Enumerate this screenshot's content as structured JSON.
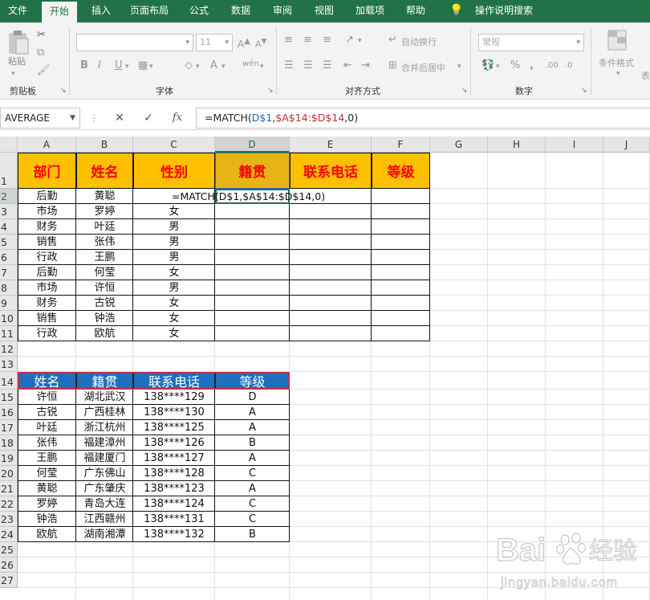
{
  "ribbon_tabs": [
    "文件",
    "开始",
    "插入",
    "页面布局",
    "公式",
    "数据",
    "审阅",
    "视图",
    "加载项",
    "帮助"
  ],
  "active_tab": "开始",
  "tell_me": "操作说明搜索",
  "ribbon": {
    "paste_label": "粘贴",
    "clipboard_label": "剪贴板",
    "font_label": "字体",
    "font_size": "11",
    "alignment_label": "对齐方式",
    "wrap_text": "自动换行",
    "merge_center": "合并后居中",
    "number_label": "数字",
    "number_format": "常规",
    "conditional_format": "条件格式",
    "table_partial": "表"
  },
  "formula_bar": {
    "name_box": "AVERAGE",
    "formula_parts": [
      {
        "text": "=MATCH(",
        "color": "default"
      },
      {
        "text": "D$1",
        "color": "blue"
      },
      {
        "text": ",",
        "color": "default"
      },
      {
        "text": "$A$14:$D$14",
        "color": "red"
      },
      {
        "text": ",0)",
        "color": "default"
      }
    ]
  },
  "columns": [
    "A",
    "B",
    "C",
    "D",
    "E",
    "F",
    "G",
    "H",
    "I",
    "J"
  ],
  "selected_column": "D",
  "selected_row": "2",
  "rows": [
    "1",
    "2",
    "3",
    "4",
    "5",
    "6",
    "7",
    "8",
    "9",
    "10",
    "11",
    "12",
    "13",
    "14",
    "15",
    "16",
    "17",
    "18",
    "19",
    "20",
    "21",
    "22",
    "23",
    "24",
    "25",
    "26",
    "27"
  ],
  "table1": {
    "headers": [
      "部门",
      "姓名",
      "性别",
      "籍贯",
      "联系电话",
      "等级"
    ],
    "rows": [
      [
        "后勤",
        "黄聪",
        ""
      ],
      [
        "市场",
        "罗婷",
        "女"
      ],
      [
        "财务",
        "叶廷",
        "男"
      ],
      [
        "销售",
        "张伟",
        "男"
      ],
      [
        "行政",
        "王鹏",
        "男"
      ],
      [
        "后勤",
        "何莹",
        "女"
      ],
      [
        "市场",
        "许恒",
        "男"
      ],
      [
        "财务",
        "古锐",
        "女"
      ],
      [
        "销售",
        "钟浩",
        "女"
      ],
      [
        "行政",
        "欧航",
        "女"
      ]
    ],
    "editing_formula": "=MATCH(D$1,$A$14:$D$14,0)"
  },
  "table2": {
    "headers": [
      "姓名",
      "籍贯",
      "联系电话",
      "等级"
    ],
    "rows": [
      [
        "许恒",
        "湖北武汉",
        "138****129",
        "D"
      ],
      [
        "古锐",
        "广西桂林",
        "138****130",
        "A"
      ],
      [
        "叶廷",
        "浙江杭州",
        "138****125",
        "A"
      ],
      [
        "张伟",
        "福建漳州",
        "138****126",
        "B"
      ],
      [
        "王鹏",
        "福建厦门",
        "138****127",
        "A"
      ],
      [
        "何莹",
        "广东佛山",
        "138****128",
        "C"
      ],
      [
        "黄聪",
        "广东肇庆",
        "138****123",
        "A"
      ],
      [
        "罗婷",
        "青岛大连",
        "138****124",
        "C"
      ],
      [
        "钟浩",
        "江西赣州",
        "138****131",
        "C"
      ],
      [
        "欧航",
        "湖南湘潭",
        "138****132",
        "B"
      ]
    ]
  },
  "watermark": {
    "brand": "Bai",
    "brand_cn": "经验",
    "url": "jingyan.baidu.com"
  },
  "colors": {
    "accent": "#217346",
    "header_fill": "#ffc000",
    "header_text": "#ff0000",
    "table2_fill": "#1e6fbd"
  }
}
